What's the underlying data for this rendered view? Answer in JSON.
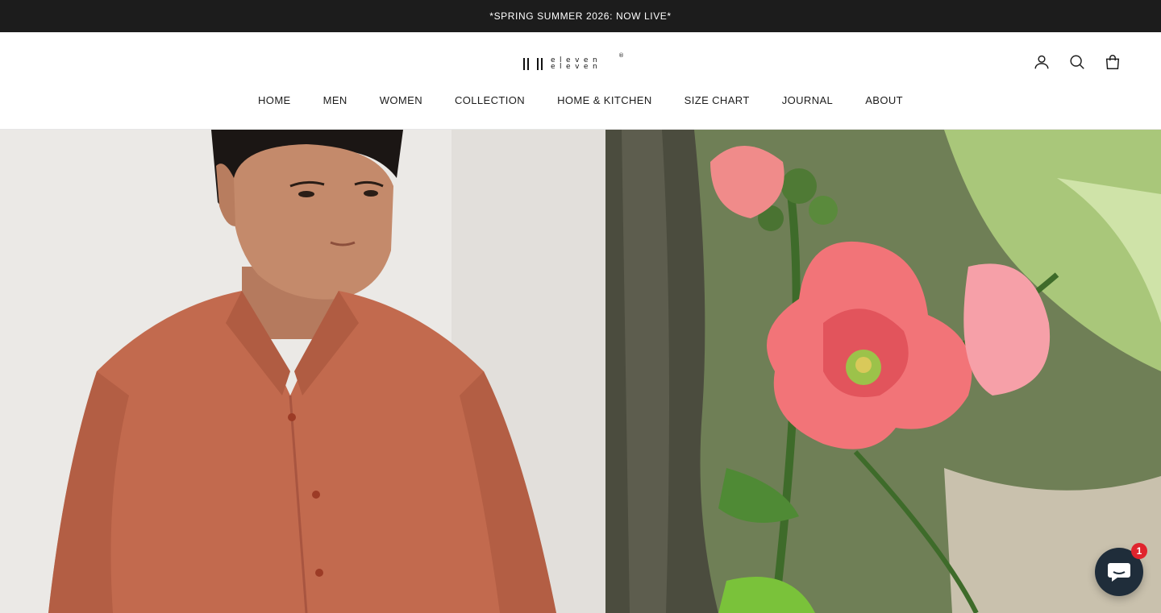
{
  "announcement": {
    "text": "*SPRING SUMMER 2026: NOW LIVE*"
  },
  "logo": {
    "line1": "eleven",
    "line2": "eleven",
    "registered": "®"
  },
  "header_icons": [
    "account-icon",
    "search-icon",
    "cart-icon"
  ],
  "nav": {
    "items": [
      {
        "label": "HOME"
      },
      {
        "label": "MEN"
      },
      {
        "label": "WOMEN"
      },
      {
        "label": "COLLECTION"
      },
      {
        "label": "HOME & KITCHEN"
      },
      {
        "label": "SIZE CHART"
      },
      {
        "label": "JOURNAL"
      },
      {
        "label": "ABOUT"
      }
    ]
  },
  "hero": {
    "left_image": "man-in-terracotta-linen-shirt",
    "right_image": "pink-hollyhock-flower"
  },
  "chat": {
    "badge_count": "1",
    "icon": "chat-bubble-icon"
  },
  "colors": {
    "announcement_bg": "#1c1c1c",
    "text": "#1c1c1c",
    "shirt": "#c26a4e",
    "chat_bg": "#1f2d3a",
    "badge": "#e0242d"
  }
}
